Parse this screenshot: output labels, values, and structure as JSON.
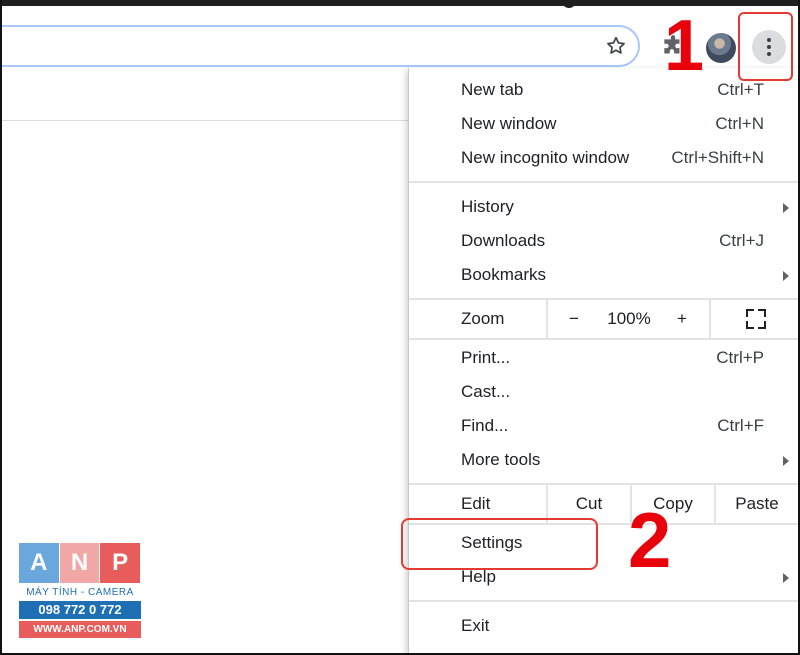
{
  "menu": {
    "group1": [
      {
        "label": "New tab",
        "shortcut": "Ctrl+T"
      },
      {
        "label": "New window",
        "shortcut": "Ctrl+N"
      },
      {
        "label": "New incognito window",
        "shortcut": "Ctrl+Shift+N"
      }
    ],
    "group2": [
      {
        "label": "History",
        "shortcut": "",
        "submenu": true
      },
      {
        "label": "Downloads",
        "shortcut": "Ctrl+J"
      },
      {
        "label": "Bookmarks",
        "shortcut": "",
        "submenu": true
      }
    ],
    "zoom": {
      "label": "Zoom",
      "minus": "−",
      "value": "100%",
      "plus": "+"
    },
    "group3": [
      {
        "label": "Print...",
        "shortcut": "Ctrl+P"
      },
      {
        "label": "Cast...",
        "shortcut": ""
      },
      {
        "label": "Find...",
        "shortcut": "Ctrl+F"
      },
      {
        "label": "More tools",
        "shortcut": "",
        "submenu": true
      }
    ],
    "edit": {
      "label": "Edit",
      "cut": "Cut",
      "copy": "Copy",
      "paste": "Paste"
    },
    "group4": [
      {
        "label": "Settings",
        "shortcut": ""
      },
      {
        "label": "Help",
        "shortcut": "",
        "submenu": true
      }
    ],
    "exit": {
      "label": "Exit"
    }
  },
  "annotations": {
    "step1": "1",
    "step2": "2"
  },
  "logo": {
    "letters": [
      "A",
      "N",
      "P"
    ],
    "subtitle": "MÁY TÍNH - CAMERA",
    "phone": "098 772 0 772",
    "website": "WWW.ANP.COM.VN"
  },
  "colors": {
    "annotation_red": "#e8000b",
    "logo_blue": "#1f6fb5",
    "logo_red": "#e85c5c",
    "omnibox_border": "#a8c7fa"
  },
  "icons": {
    "bookmark": "star-icon",
    "extensions": "puzzle-icon",
    "menu": "three-dots-icon",
    "fullscreen": "fullscreen-icon"
  }
}
